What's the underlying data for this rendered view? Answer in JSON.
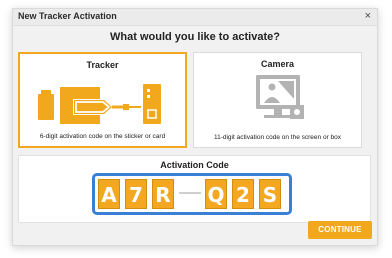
{
  "dialog": {
    "title": "New Tracker Activation",
    "close_icon": "×",
    "question": "What would you like to activate?"
  },
  "options": {
    "tracker": {
      "title": "Tracker",
      "description": "6-digit activation code on the sticker or card",
      "icon": "tracker-device-icon",
      "selected": true
    },
    "camera": {
      "title": "Camera",
      "description": "11-digit activation code on the screen or box",
      "icon": "camera-device-icon",
      "selected": false
    }
  },
  "activation": {
    "label": "Activation Code",
    "chars": [
      "A",
      "7",
      "R",
      "Q",
      "2",
      "S"
    ]
  },
  "footer": {
    "continue_label": "CONTINUE"
  },
  "colors": {
    "accent": "#f2a81d",
    "code_border": "#3a7fd6",
    "camera_icon": "#b3b3b3"
  }
}
